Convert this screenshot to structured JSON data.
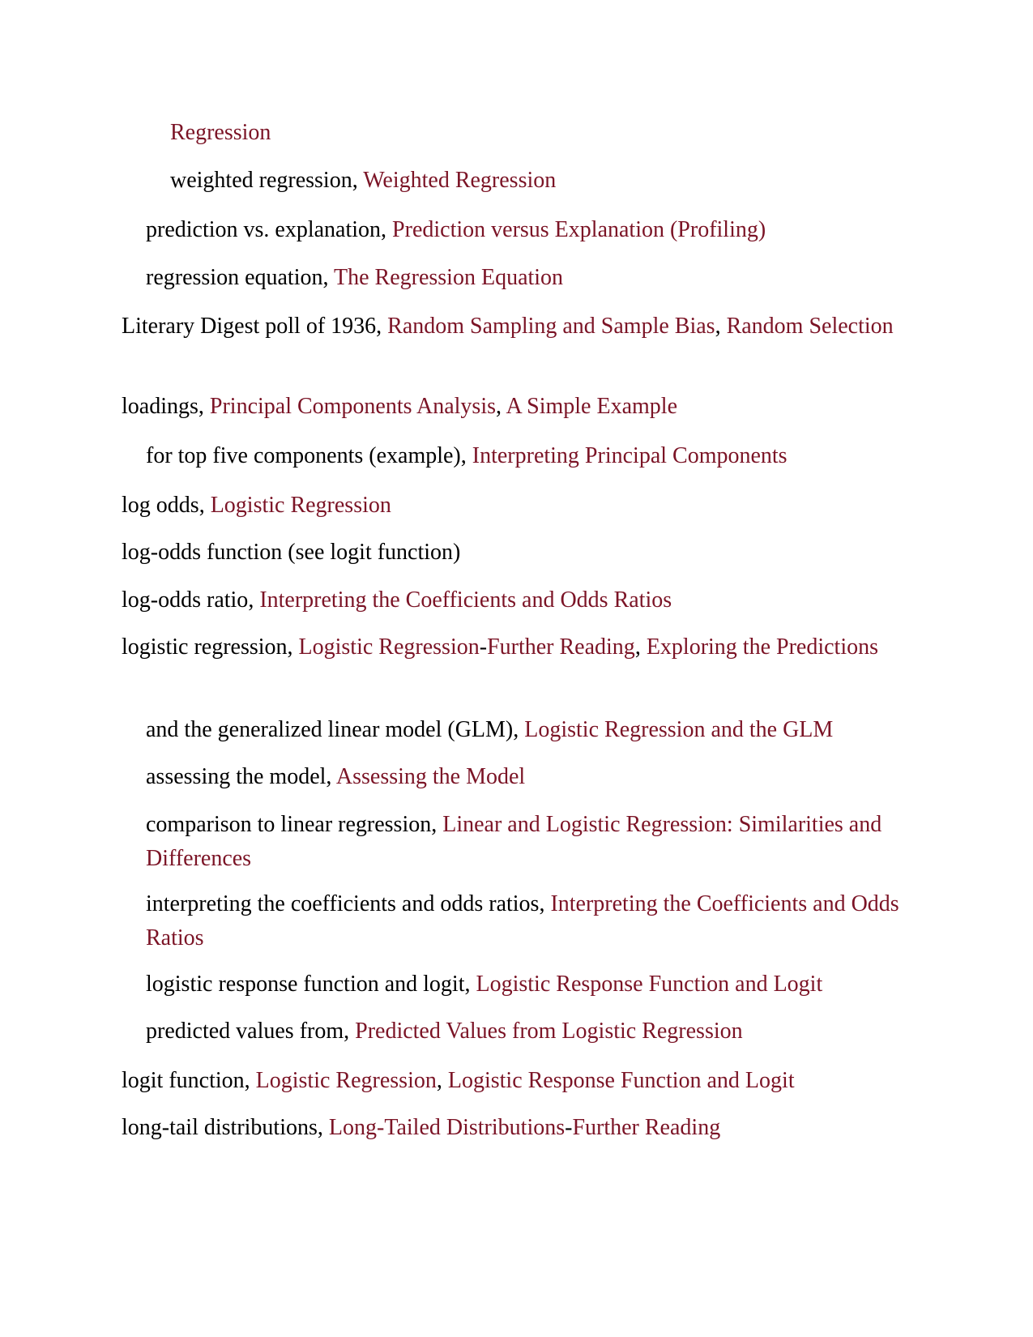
{
  "colors": {
    "text": "#000000",
    "link": "#7b1426",
    "background": "#ffffff"
  },
  "entries": [
    {
      "term": "",
      "sep1": "",
      "link1": "Regression"
    },
    {
      "term": "weighted regression",
      "sep1": ", ",
      "link1": "Weighted Regression"
    },
    {
      "term": "prediction vs. explanation",
      "sep1": ", ",
      "link1": "Prediction versus Explanation (Profiling)"
    },
    {
      "term": "regression equation",
      "sep1": ", ",
      "link1": "The Regression Equation"
    },
    {
      "term": "Literary Digest poll of 1936",
      "sep1": ", ",
      "link1": "Random Sampling and Sample Bias",
      "sep2": ", ",
      "link2": "Random Selection"
    },
    {
      "term": "loadings",
      "sep1": ", ",
      "link1": "Principal Components Analysis",
      "sep2": ", ",
      "link2": "A Simple Example"
    },
    {
      "term": "for top five components (example)",
      "sep1": ", ",
      "link1": "Interpreting Principal Components"
    },
    {
      "term": "log odds",
      "sep1": ", ",
      "link1": "Logistic Regression"
    },
    {
      "term": "log-odds function (see logit function)"
    },
    {
      "term": "log-odds ratio",
      "sep1": ", ",
      "link1": "Interpreting the Coefficients and Odds Ratios"
    },
    {
      "term": "logistic regression",
      "sep1": ", ",
      "link1": "Logistic Regression",
      "sep2": "-",
      "link2": "Further Reading",
      "sep3": ", ",
      "link3": "Exploring the Predictions"
    },
    {
      "term": "and the generalized linear model (GLM)",
      "sep1": ", ",
      "link1": "Logistic Regression and the GLM"
    },
    {
      "term": "assessing the model",
      "sep1": ", ",
      "link1": "Assessing the Model"
    },
    {
      "term": "comparison to linear regression",
      "sep1": ", ",
      "link1": "Linear and Logistic Regression: Similarities and Differences"
    },
    {
      "term": "interpreting the coefficients and odds ratios",
      "sep1": ", ",
      "link1": "Interpreting the Coefficients and Odds Ratios"
    },
    {
      "term": "logistic response function and logit",
      "sep1": ", ",
      "link1": "Logistic Response Function and Logit"
    },
    {
      "term": "predicted values from",
      "sep1": ", ",
      "link1": "Predicted Values from Logistic Regression"
    },
    {
      "term": "logit function",
      "sep1": ", ",
      "link1": "Logistic Regression",
      "sep2": ", ",
      "link2": "Logistic Response Function and Logit"
    },
    {
      "term": "long-tail distributions",
      "sep1": ", ",
      "link1": "Long-Tailed Distributions",
      "sep2": "-",
      "link2": "Further Reading"
    }
  ]
}
